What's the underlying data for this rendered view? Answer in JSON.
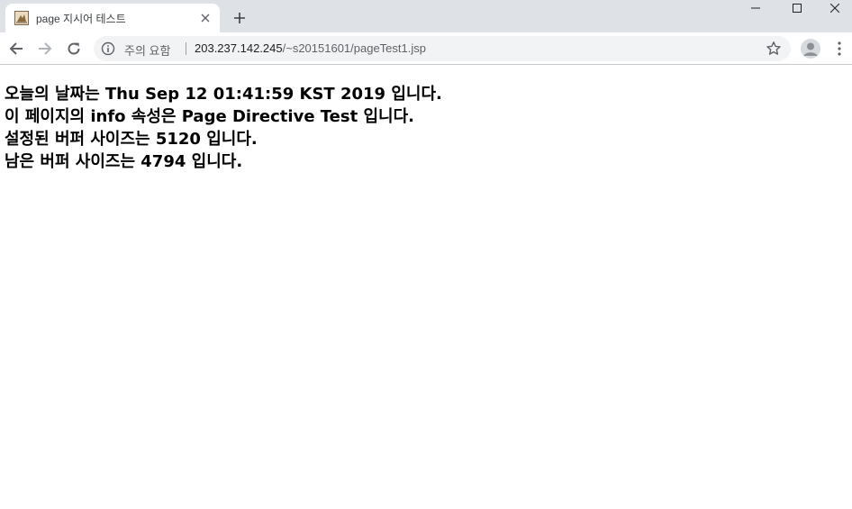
{
  "browser": {
    "tab": {
      "title": "page 지시어 테스트",
      "favicon": "page-favicon"
    },
    "new_tab_symbol": "+",
    "window_controls": [
      "minimize-icon",
      "maximize-icon",
      "close-icon"
    ],
    "address_bar": {
      "security_label": "주의 요함",
      "url_host": "203.237.142.245",
      "url_path": "/~s20151601/pageTest1.jsp"
    },
    "icons": {
      "back": "back-arrow-icon",
      "forward": "forward-arrow-icon",
      "reload": "reload-icon",
      "info": "info-icon",
      "bookmark": "star-icon",
      "profile": "avatar-icon",
      "menu": "kebab-menu-icon"
    }
  },
  "page": {
    "lines": [
      "오늘의 날짜는 Thu Sep 12 01:41:59 KST 2019 입니다.",
      "이 페이지의 info 속성은 Page Directive Test 입니다.",
      "설정된 버퍼 사이즈는 5120 입니다.",
      "남은 버퍼 사이즈는 4794 입니다."
    ]
  }
}
